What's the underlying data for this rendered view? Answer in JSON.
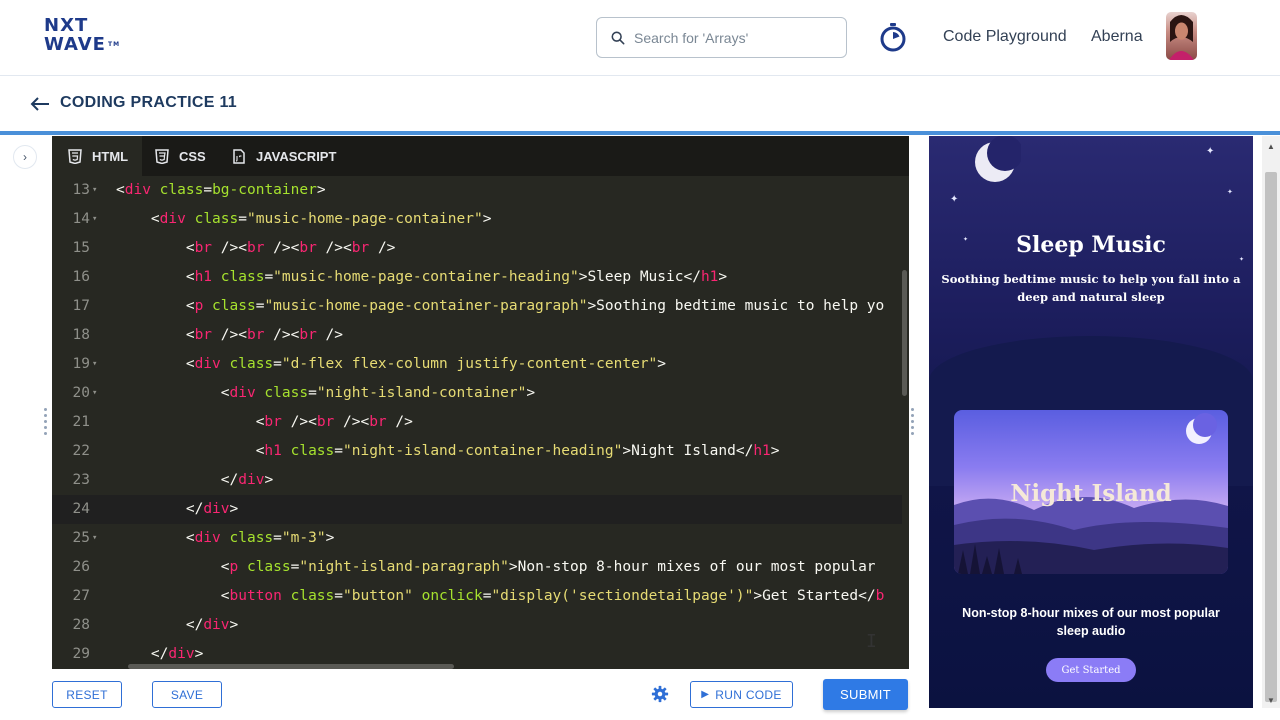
{
  "topnav": {
    "logo_line1": "NXT",
    "logo_line2": "WAVE",
    "logo_tm": "TM",
    "search_placeholder": "Search for 'Arrays'",
    "code_playground": "Code Playground",
    "username": "Aberna"
  },
  "subheader": {
    "title": "CODING PRACTICE 11"
  },
  "editor": {
    "tabs": [
      {
        "label": "HTML",
        "icon": "html5-icon"
      },
      {
        "label": "CSS",
        "icon": "css3-icon"
      },
      {
        "label": "JAVASCRIPT",
        "icon": "js-file-icon"
      }
    ],
    "active_line": "24",
    "lines": [
      {
        "num": "13",
        "indent": "",
        "code": [
          [
            "p",
            "<"
          ],
          [
            "t",
            "div"
          ],
          [
            "a",
            " class"
          ],
          [
            "p",
            "="
          ],
          [
            "a",
            "bg-container"
          ],
          [
            "p",
            ">"
          ]
        ]
      },
      {
        "num": "14",
        "indent": "    ",
        "code": [
          [
            "p",
            "<"
          ],
          [
            "t",
            "div"
          ],
          [
            "a",
            " class"
          ],
          [
            "p",
            "="
          ],
          [
            "s",
            "\"music-home-page-container\""
          ],
          [
            "p",
            ">"
          ]
        ]
      },
      {
        "num": "15",
        "indent": "        ",
        "code": [
          [
            "p",
            "<"
          ],
          [
            "t",
            "br"
          ],
          [
            "p",
            " /><"
          ],
          [
            "t",
            "br"
          ],
          [
            "p",
            " /><"
          ],
          [
            "t",
            "br"
          ],
          [
            "p",
            " /><"
          ],
          [
            "t",
            "br"
          ],
          [
            "p",
            " />"
          ]
        ]
      },
      {
        "num": "16",
        "indent": "        ",
        "code": [
          [
            "p",
            "<"
          ],
          [
            "t",
            "h1"
          ],
          [
            "a",
            " class"
          ],
          [
            "p",
            "="
          ],
          [
            "s",
            "\"music-home-page-container-heading\""
          ],
          [
            "p",
            ">Sleep Music</"
          ],
          [
            "t",
            "h1"
          ],
          [
            "p",
            ">"
          ]
        ]
      },
      {
        "num": "17",
        "indent": "        ",
        "code": [
          [
            "p",
            "<"
          ],
          [
            "t",
            "p"
          ],
          [
            "a",
            " class"
          ],
          [
            "p",
            "="
          ],
          [
            "s",
            "\"music-home-page-container-paragraph\""
          ],
          [
            "p",
            ">Soothing bedtime music to help yo"
          ]
        ]
      },
      {
        "num": "18",
        "indent": "        ",
        "code": [
          [
            "p",
            "<"
          ],
          [
            "t",
            "br"
          ],
          [
            "p",
            " /><"
          ],
          [
            "t",
            "br"
          ],
          [
            "p",
            " /><"
          ],
          [
            "t",
            "br"
          ],
          [
            "p",
            " />"
          ]
        ]
      },
      {
        "num": "19",
        "indent": "        ",
        "code": [
          [
            "p",
            "<"
          ],
          [
            "t",
            "div"
          ],
          [
            "a",
            " class"
          ],
          [
            "p",
            "="
          ],
          [
            "s",
            "\"d-flex flex-column justify-content-center\""
          ],
          [
            "p",
            ">"
          ]
        ]
      },
      {
        "num": "20",
        "indent": "            ",
        "code": [
          [
            "p",
            "<"
          ],
          [
            "t",
            "div"
          ],
          [
            "a",
            " class"
          ],
          [
            "p",
            "="
          ],
          [
            "s",
            "\"night-island-container\""
          ],
          [
            "p",
            ">"
          ]
        ]
      },
      {
        "num": "21",
        "indent": "                ",
        "code": [
          [
            "p",
            "<"
          ],
          [
            "t",
            "br"
          ],
          [
            "p",
            " /><"
          ],
          [
            "t",
            "br"
          ],
          [
            "p",
            " /><"
          ],
          [
            "t",
            "br"
          ],
          [
            "p",
            " />"
          ]
        ]
      },
      {
        "num": "22",
        "indent": "                ",
        "code": [
          [
            "p",
            "<"
          ],
          [
            "t",
            "h1"
          ],
          [
            "a",
            " class"
          ],
          [
            "p",
            "="
          ],
          [
            "s",
            "\"night-island-container-heading\""
          ],
          [
            "p",
            ">Night Island</"
          ],
          [
            "t",
            "h1"
          ],
          [
            "p",
            ">"
          ]
        ]
      },
      {
        "num": "23",
        "indent": "            ",
        "code": [
          [
            "p",
            "</"
          ],
          [
            "t",
            "div"
          ],
          [
            "p",
            ">"
          ]
        ]
      },
      {
        "num": "24",
        "indent": "        ",
        "code": [
          [
            "p",
            "</"
          ],
          [
            "t",
            "div"
          ],
          [
            "p",
            ">"
          ]
        ]
      },
      {
        "num": "25",
        "indent": "        ",
        "code": [
          [
            "p",
            "<"
          ],
          [
            "t",
            "div"
          ],
          [
            "a",
            " class"
          ],
          [
            "p",
            "="
          ],
          [
            "s",
            "\"m-3\""
          ],
          [
            "p",
            ">"
          ]
        ]
      },
      {
        "num": "26",
        "indent": "            ",
        "code": [
          [
            "p",
            "<"
          ],
          [
            "t",
            "p"
          ],
          [
            "a",
            " class"
          ],
          [
            "p",
            "="
          ],
          [
            "s",
            "\"night-island-paragraph\""
          ],
          [
            "p",
            ">Non-stop 8-hour mixes of our most popular"
          ]
        ]
      },
      {
        "num": "27",
        "indent": "            ",
        "code": [
          [
            "p",
            "<"
          ],
          [
            "t",
            "button"
          ],
          [
            "a",
            " class"
          ],
          [
            "p",
            "="
          ],
          [
            "s",
            "\"button\""
          ],
          [
            "a",
            " onclick"
          ],
          [
            "p",
            "="
          ],
          [
            "s",
            "\"display('sectiondetailpage')\""
          ],
          [
            "p",
            ">Get Started</"
          ],
          [
            "t",
            "b"
          ]
        ]
      },
      {
        "num": "28",
        "indent": "        ",
        "code": [
          [
            "p",
            "</"
          ],
          [
            "t",
            "div"
          ],
          [
            "p",
            ">"
          ]
        ]
      },
      {
        "num": "29",
        "indent": "    ",
        "code": [
          [
            "p",
            "</"
          ],
          [
            "t",
            "div"
          ],
          [
            "p",
            ">"
          ]
        ]
      }
    ],
    "folded_lines": [
      "13",
      "14",
      "19",
      "20",
      "25"
    ]
  },
  "bottombar": {
    "reset": "RESET",
    "save": "SAVE",
    "run_code": "RUN CODE",
    "submit": "SUBMIT"
  },
  "preview": {
    "heading": "Sleep Music",
    "paragraph": "Soothing bedtime music to help you fall into a deep and natural sleep",
    "island_heading": "Night Island",
    "island_paragraph": "Non-stop 8-hour mixes of our most popular sleep audio",
    "button": "Get Started"
  },
  "colors": {
    "brand": "#1e3a8a",
    "accent_blue": "#2f7ae5",
    "editor_bg": "#272822",
    "preview_bg": "#1d1e5e"
  }
}
